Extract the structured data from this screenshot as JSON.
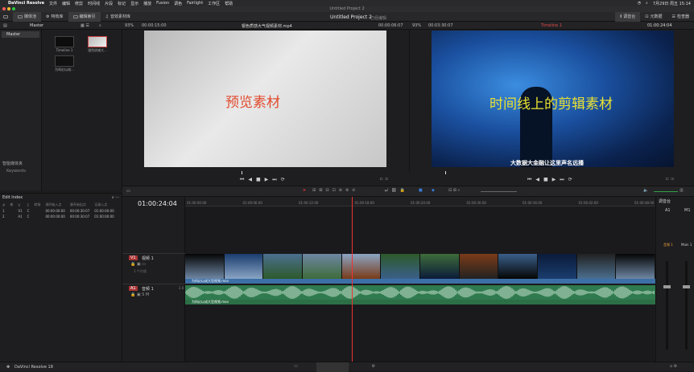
{
  "menubar": {
    "app": "DaVinci Resolve",
    "items": [
      "文件",
      "编辑",
      "修剪",
      "时间线",
      "片段",
      "标记",
      "显示",
      "播放",
      "Fusion",
      "调色",
      "Fairlight",
      "工作区",
      "帮助"
    ],
    "clock": "7月29日 周五 15:14"
  },
  "window": {
    "title": "Untitled Project 2"
  },
  "toolbar": {
    "left": [
      "媒体池",
      "特效库",
      "编辑索引",
      "音效素材库"
    ],
    "project_title": "Untitled Project 2",
    "project_state": "已经编辑",
    "right": [
      "调音台",
      "元数据",
      "检查器"
    ]
  },
  "viewer_left": {
    "zoom": "93%",
    "timecode_in": "00:00:15:00",
    "clip_name": "银色质感大气视频素材.mp4",
    "timecode_out": "00:00:06:07",
    "overlay_text": "预览素材"
  },
  "viewer_right": {
    "zoom": "93%",
    "duration": "00:03:30:07",
    "timeline_name": "Timeline 1",
    "timecode": "01:00:24:04",
    "overlay_text": "时间线上的剪辑素材",
    "subtitle": "大数据大金融让这里声名远播"
  },
  "media_pool": {
    "bin": "Master",
    "header_label": "Master",
    "clips": [
      {
        "label": "Timeline 1"
      },
      {
        "label": "银色质感大..."
      },
      {
        "label": "为科幻以成..."
      }
    ],
    "smart_bins": "智能媒体夹",
    "smart_bin_item": "Keywords"
  },
  "edit_index": {
    "title": "Edit Index",
    "columns": [
      "#",
      "卷",
      "V",
      "C",
      "转场",
      "源开始入点",
      "源开始出点",
      "记录入点",
      "记录出点"
    ],
    "rows": [
      [
        "1",
        "",
        "V1",
        "C",
        "",
        "00:00:00:00",
        "00:00:30:07",
        "01:00:00:00",
        "01:00:30:07"
      ],
      [
        "2",
        "",
        "A1",
        "C",
        "",
        "00:00:00:00",
        "00:00:30:07",
        "01:00:00:00",
        "01:00:30:07"
      ]
    ]
  },
  "timeline": {
    "timecode": "01:00:24:04",
    "ruler": [
      "01:00:00:00",
      "01:00:06:00",
      "01:00:12:00",
      "01:00:18:00",
      "01:00:24:00",
      "01:00:30:00",
      "01:00:36:00",
      "01:00:42:00",
      "01:00:48:00",
      "01:00:54:00"
    ],
    "video_track": {
      "id": "V1",
      "name": "视频 1",
      "clips_count": "1 个片段"
    },
    "audio_track": {
      "id": "A1",
      "name": "音频 1",
      "level": "2.0"
    },
    "video_clip_name": "为科幻以成大型视频.mov",
    "audio_clip_name": "为科幻以成大型视频.mov"
  },
  "mixer": {
    "title": "调音台",
    "channels": [
      "A1",
      "M1"
    ],
    "bus_labels": [
      "音频 1",
      "Main 1"
    ]
  },
  "statusbar": {
    "app": "DaVinci Resolve 18"
  },
  "colors": {
    "playhead": "#e33333",
    "video_track_label": "#3c6fa6",
    "audio_clip": "#2f7a4e",
    "left_overlay": "#e14b2e",
    "right_overlay": "#e9e233",
    "timeline_name": "#e34a4a"
  }
}
